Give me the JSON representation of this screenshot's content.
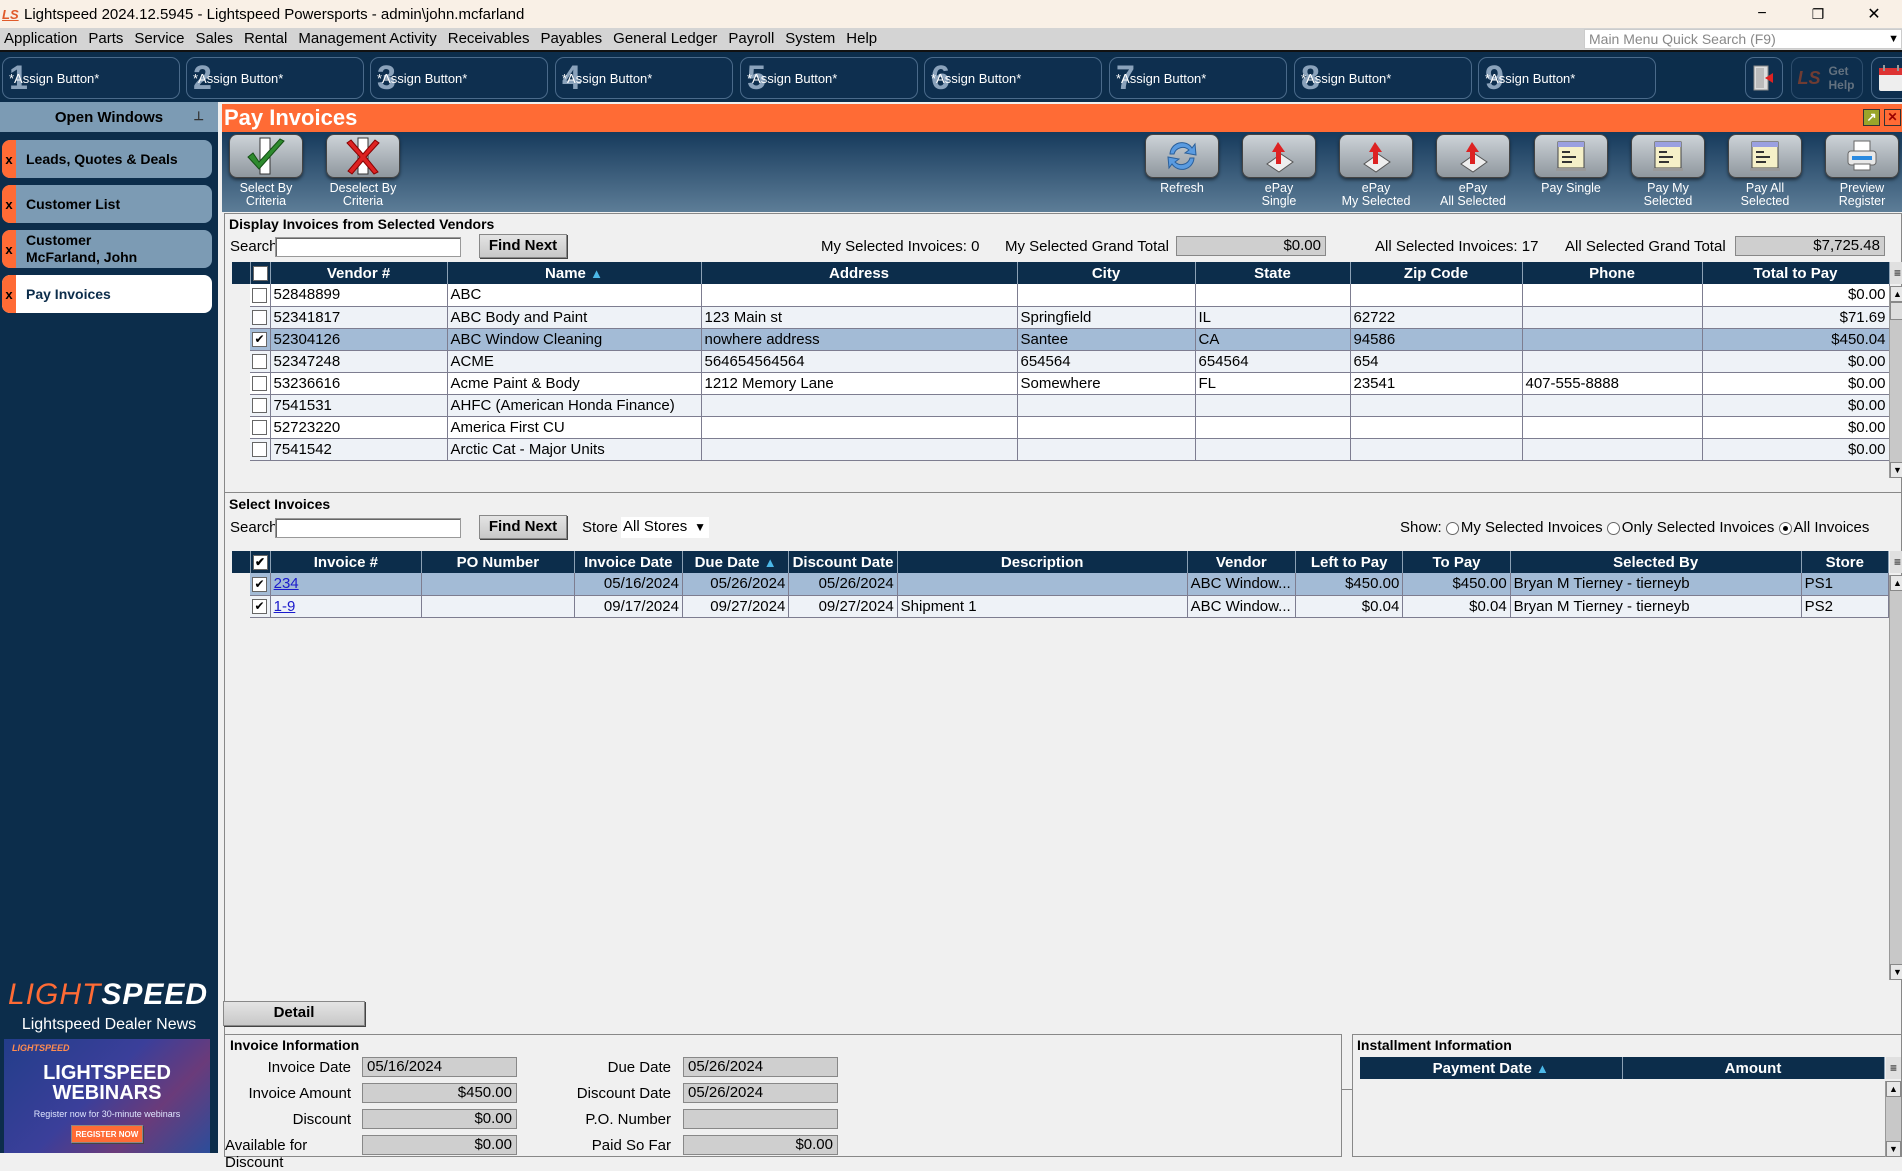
{
  "window": {
    "logo": "LS",
    "title": "Lightspeed 2024.12.5945 - Lightspeed Powersports - admin\\john.mcfarland",
    "minimize": "−",
    "restore": "❐",
    "close": "✕"
  },
  "menu": [
    "Application",
    "Parts",
    "Service",
    "Sales",
    "Rental",
    "Management Activity",
    "Receivables",
    "Payables",
    "General Ledger",
    "Payroll",
    "System",
    "Help"
  ],
  "quick_search": {
    "placeholder": "Main Menu Quick Search (F9)"
  },
  "assign_buttons": [
    {
      "num": "1",
      "label": "*Assign Button*"
    },
    {
      "num": "2",
      "label": "*Assign Button*"
    },
    {
      "num": "3",
      "label": "*Assign Button*"
    },
    {
      "num": "4",
      "label": "*Assign Button*"
    },
    {
      "num": "5",
      "label": "*Assign Button*"
    },
    {
      "num": "6",
      "label": "*Assign Button*"
    },
    {
      "num": "7",
      "label": "*Assign Button*"
    },
    {
      "num": "8",
      "label": "*Assign Button*"
    },
    {
      "num": "9",
      "label": "*Assign Button*"
    }
  ],
  "toolbar_right": {
    "get_help": "Get Help",
    "ls": "LS"
  },
  "sidebar": {
    "header": "Open Windows",
    "windows": [
      {
        "close": "x",
        "label": "Leads, Quotes & Deals",
        "active": false
      },
      {
        "close": "x",
        "label": "Customer List",
        "active": false
      },
      {
        "close": "x",
        "label": "Customer\nMcFarland, John",
        "active": false
      },
      {
        "close": "x",
        "label": "Pay Invoices",
        "active": true
      }
    ],
    "brand_light": "LIGHT",
    "brand_speed": "SPEED",
    "dealer_news": "Lightspeed Dealer News",
    "ad": {
      "small": "LIGHTSPEED",
      "headline1": "LIGHTSPEED",
      "headline2": "WEBINARS",
      "subtext": "Register now for 30-minute webinars",
      "button": "REGISTER NOW"
    }
  },
  "page": {
    "title": "Pay Invoices",
    "actions_left": [
      {
        "label": "Select By\nCriteria",
        "icon": "checkmark-icon"
      },
      {
        "label": "Deselect By\nCriteria",
        "icon": "red-x-icon"
      }
    ],
    "actions_right": [
      {
        "label": "Refresh",
        "icon": "refresh-icon"
      },
      {
        "label": "ePay\nSingle",
        "icon": "epay-icon"
      },
      {
        "label": "ePay\nMy Selected",
        "icon": "epay-icon"
      },
      {
        "label": "ePay\nAll Selected",
        "icon": "epay-icon"
      },
      {
        "label": "Pay Single",
        "icon": "ledger-icon"
      },
      {
        "label": "Pay My\nSelected",
        "icon": "ledger-icon"
      },
      {
        "label": "Pay All\nSelected",
        "icon": "ledger-icon"
      },
      {
        "label": "Preview\nRegister",
        "icon": "printer-icon"
      }
    ]
  },
  "vendors": {
    "section_title": "Display Invoices from Selected Vendors",
    "search_label": "Search",
    "search_value": "",
    "find_next": "Find Next",
    "my_selected_invoices": "My Selected Invoices: 0",
    "my_grand_total_label": "My Selected Grand Total",
    "my_grand_total": "$0.00",
    "all_selected_invoices": "All Selected Invoices: 17",
    "all_grand_total_label": "All Selected Grand Total",
    "all_grand_total": "$7,725.48",
    "columns": [
      "Vendor #",
      "Name",
      "Address",
      "City",
      "State",
      "Zip Code",
      "Phone",
      "Total to Pay"
    ],
    "sort_column": "Name",
    "rows": [
      {
        "checked": false,
        "selected": false,
        "vendor": "52848899",
        "name": "ABC",
        "address": "",
        "city": "",
        "state": "",
        "zip": "",
        "phone": "",
        "total": "$0.00"
      },
      {
        "checked": false,
        "selected": false,
        "vendor": "52341817",
        "name": "ABC Body and Paint",
        "address": "123 Main st",
        "city": "Springfield",
        "state": "IL",
        "zip": "62722",
        "phone": "",
        "total": "$71.69"
      },
      {
        "checked": true,
        "selected": true,
        "vendor": "52304126",
        "name": "ABC Window Cleaning",
        "address": "nowhere address",
        "city": "Santee",
        "state": "CA",
        "zip": "94586",
        "phone": "",
        "total": "$450.04"
      },
      {
        "checked": false,
        "selected": false,
        "vendor": "52347248",
        "name": "ACME",
        "address": "564654564564",
        "city": "654564",
        "state": "654564",
        "zip": "654",
        "phone": "",
        "total": "$0.00"
      },
      {
        "checked": false,
        "selected": false,
        "vendor": "53236616",
        "name": "Acme Paint & Body",
        "address": "1212 Memory Lane",
        "city": "Somewhere",
        "state": "FL",
        "zip": "23541",
        "phone": "407-555-8888",
        "total": "$0.00"
      },
      {
        "checked": false,
        "selected": false,
        "vendor": "7541531",
        "name": "AHFC (American Honda Finance)",
        "address": "",
        "city": "",
        "state": "",
        "zip": "",
        "phone": "",
        "total": "$0.00"
      },
      {
        "checked": false,
        "selected": false,
        "vendor": "52723220",
        "name": "America First CU",
        "address": "",
        "city": "",
        "state": "",
        "zip": "",
        "phone": "",
        "total": "$0.00"
      },
      {
        "checked": false,
        "selected": false,
        "vendor": "7541542",
        "name": "Arctic Cat - Major Units",
        "address": "",
        "city": "",
        "state": "",
        "zip": "",
        "phone": "",
        "total": "$0.00"
      }
    ]
  },
  "invoices": {
    "section_title": "Select Invoices",
    "search_label": "Search",
    "search_value": "",
    "find_next": "Find Next",
    "store_label": "Store",
    "store_value": "All Stores",
    "show_label": "Show:",
    "show_options": [
      {
        "label": "My Selected Invoices",
        "selected": false
      },
      {
        "label": "Only Selected Invoices",
        "selected": false
      },
      {
        "label": "All Invoices",
        "selected": true
      }
    ],
    "columns": [
      "Invoice #",
      "PO Number",
      "Invoice Date",
      "Due Date",
      "Discount Date",
      "Description",
      "Vendor",
      "Left to Pay",
      "To Pay",
      "Selected By",
      "Store"
    ],
    "sort_column": "Due Date",
    "rows": [
      {
        "checked": true,
        "selected": true,
        "invoice": "234",
        "po": "",
        "invoice_date": "05/16/2024",
        "due_date": "05/26/2024",
        "discount_date": "05/26/2024",
        "description": "",
        "vendor": "ABC Window...",
        "left_to_pay": "$450.00",
        "to_pay": "$450.00",
        "selected_by": "Bryan M Tierney - tierneyb",
        "store": "PS1"
      },
      {
        "checked": true,
        "selected": false,
        "invoice": "1-9",
        "po": "",
        "invoice_date": "09/17/2024",
        "due_date": "09/27/2024",
        "discount_date": "09/27/2024",
        "description": "Shipment 1",
        "vendor": "ABC Window...",
        "left_to_pay": "$0.04",
        "to_pay": "$0.04",
        "selected_by": "Bryan M Tierney - tierneyb",
        "store": "PS2"
      }
    ]
  },
  "detail_button": "Detail",
  "invoice_info": {
    "title": "Invoice Information",
    "invoice_date_label": "Invoice Date",
    "invoice_date": "05/16/2024",
    "invoice_amount_label": "Invoice Amount",
    "invoice_amount": "$450.00",
    "discount_label": "Discount",
    "discount": "$0.00",
    "available_discount_label": "Available for Discount",
    "available_discount": "$0.00",
    "due_date_label": "Due Date",
    "due_date": "05/26/2024",
    "discount_date_label": "Discount Date",
    "discount_date": "05/26/2024",
    "po_number_label": "P.O. Number",
    "po_number": "",
    "paid_so_far_label": "Paid So Far",
    "paid_so_far": "$0.00"
  },
  "installment_info": {
    "title": "Installment Information",
    "columns": [
      "Payment Date",
      "Amount"
    ],
    "sort_column": "Payment Date"
  }
}
